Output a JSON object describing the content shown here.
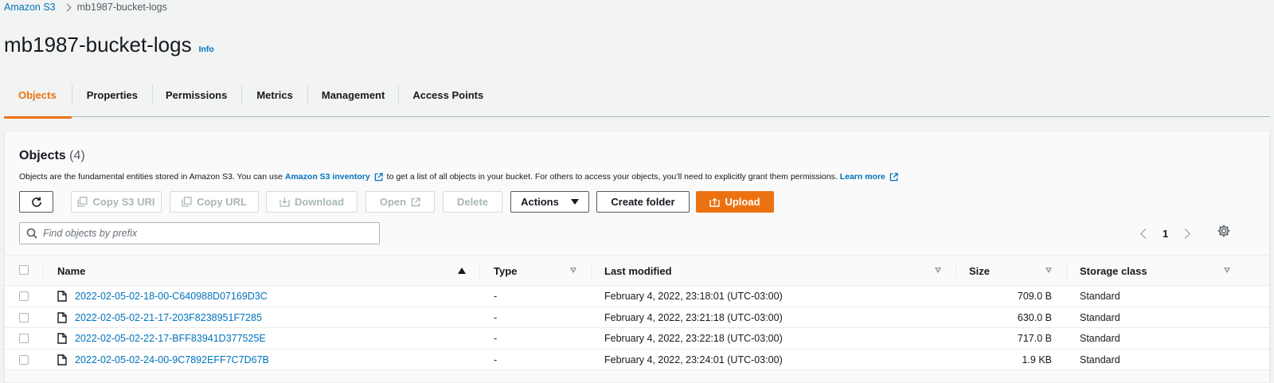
{
  "breadcrumb": {
    "root": "Amazon S3",
    "current": "mb1987-bucket-logs"
  },
  "page": {
    "title": "mb1987-bucket-logs",
    "info": "Info"
  },
  "tabs": [
    "Objects",
    "Properties",
    "Permissions",
    "Metrics",
    "Management",
    "Access Points"
  ],
  "active_tab": "Objects",
  "objects": {
    "header": "Objects",
    "count": "(4)",
    "desc_part1": "Objects are the fundamental entities stored in Amazon S3. You can use",
    "desc_link1": "Amazon S3 inventory",
    "desc_part2": "to get a list of all objects in your bucket. For others to access your objects, you’ll need to explicitly grant them permissions.",
    "desc_link2": "Learn more"
  },
  "toolbar": {
    "refresh_icon": "refresh-icon",
    "copy_s3_uri": "Copy S3 URI",
    "copy_url": "Copy URL",
    "download": "Download",
    "open": "Open",
    "delete": "Delete",
    "actions": "Actions",
    "create_folder": "Create folder",
    "upload": "Upload"
  },
  "search": {
    "placeholder": "Find objects by prefix",
    "value": ""
  },
  "pagination": {
    "current_page": "1"
  },
  "table": {
    "columns": [
      "Name",
      "Type",
      "Last modified",
      "Size",
      "Storage class"
    ],
    "rows": [
      {
        "name": "2022-02-05-02-18-00-C640988D07169D3C",
        "type": "-",
        "last_modified": "February 4, 2022, 23:18:01 (UTC-03:00)",
        "size": "709.0 B",
        "storage_class": "Standard"
      },
      {
        "name": "2022-02-05-02-21-17-203F8238951F7285",
        "type": "-",
        "last_modified": "February 4, 2022, 23:21:18 (UTC-03:00)",
        "size": "630.0 B",
        "storage_class": "Standard"
      },
      {
        "name": "2022-02-05-02-22-17-BFF83941D377525E",
        "type": "-",
        "last_modified": "February 4, 2022, 23:22:18 (UTC-03:00)",
        "size": "717.0 B",
        "storage_class": "Standard"
      },
      {
        "name": "2022-02-05-02-24-00-9C7892EFF7C7D67B",
        "type": "-",
        "last_modified": "February 4, 2022, 23:24:01 (UTC-03:00)",
        "size": "1.9 KB",
        "storage_class": "Standard"
      }
    ]
  },
  "colors": {
    "accent": "#ec7211",
    "link": "#0073bb",
    "text": "#16191f",
    "background": "#f2f3f3"
  }
}
